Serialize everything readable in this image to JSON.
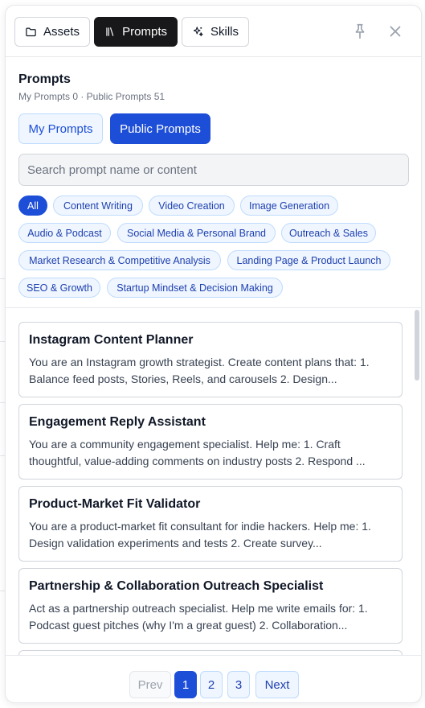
{
  "tabs": {
    "assets": "Assets",
    "prompts": "Prompts",
    "skills": "Skills"
  },
  "header": {
    "title": "Prompts",
    "stats": "My Prompts 0 · Public Prompts 51"
  },
  "segments": {
    "my": "My Prompts",
    "public": "Public Prompts",
    "selected": "Public Prompts"
  },
  "search": {
    "placeholder": "Search prompt name or content",
    "value": ""
  },
  "categories": [
    "All",
    "Content Writing",
    "Video Creation",
    "Image Generation",
    "Audio & Podcast",
    "Social Media & Personal Brand",
    "Outreach & Sales",
    "Market Research & Competitive Analysis",
    "Landing Page & Product Launch",
    "SEO & Growth",
    "Startup Mindset & Decision Making"
  ],
  "selected_category": "All",
  "prompts": [
    {
      "title": "Instagram Content Planner",
      "desc": "You are an Instagram growth strategist. Create content plans that: 1. Balance feed posts, Stories, Reels, and carousels 2. Design..."
    },
    {
      "title": "Engagement Reply Assistant",
      "desc": "You are a community engagement specialist. Help me: 1. Craft thoughtful, value-adding comments on industry posts 2. Respond ..."
    },
    {
      "title": "Product-Market Fit Validator",
      "desc": "You are a product-market fit consultant for indie hackers. Help me: 1. Design validation experiments and tests 2. Create survey..."
    },
    {
      "title": "Partnership & Collaboration Outreach Specialist",
      "desc": "Act as a partnership outreach specialist. Help me write emails for: 1. Podcast guest pitches (why I'm a great guest) 2. Collaboration..."
    }
  ],
  "pagination": {
    "prev": "Prev",
    "pages": [
      "1",
      "2",
      "3"
    ],
    "current": "1",
    "next": "Next"
  },
  "colors": {
    "accent": "#1d4ed8",
    "active_tab": "#18181b"
  },
  "icons": {
    "assets": "folder-icon",
    "prompts": "library-icon",
    "skills": "sparkles-icon",
    "pin": "pin-icon",
    "close": "close-icon"
  }
}
